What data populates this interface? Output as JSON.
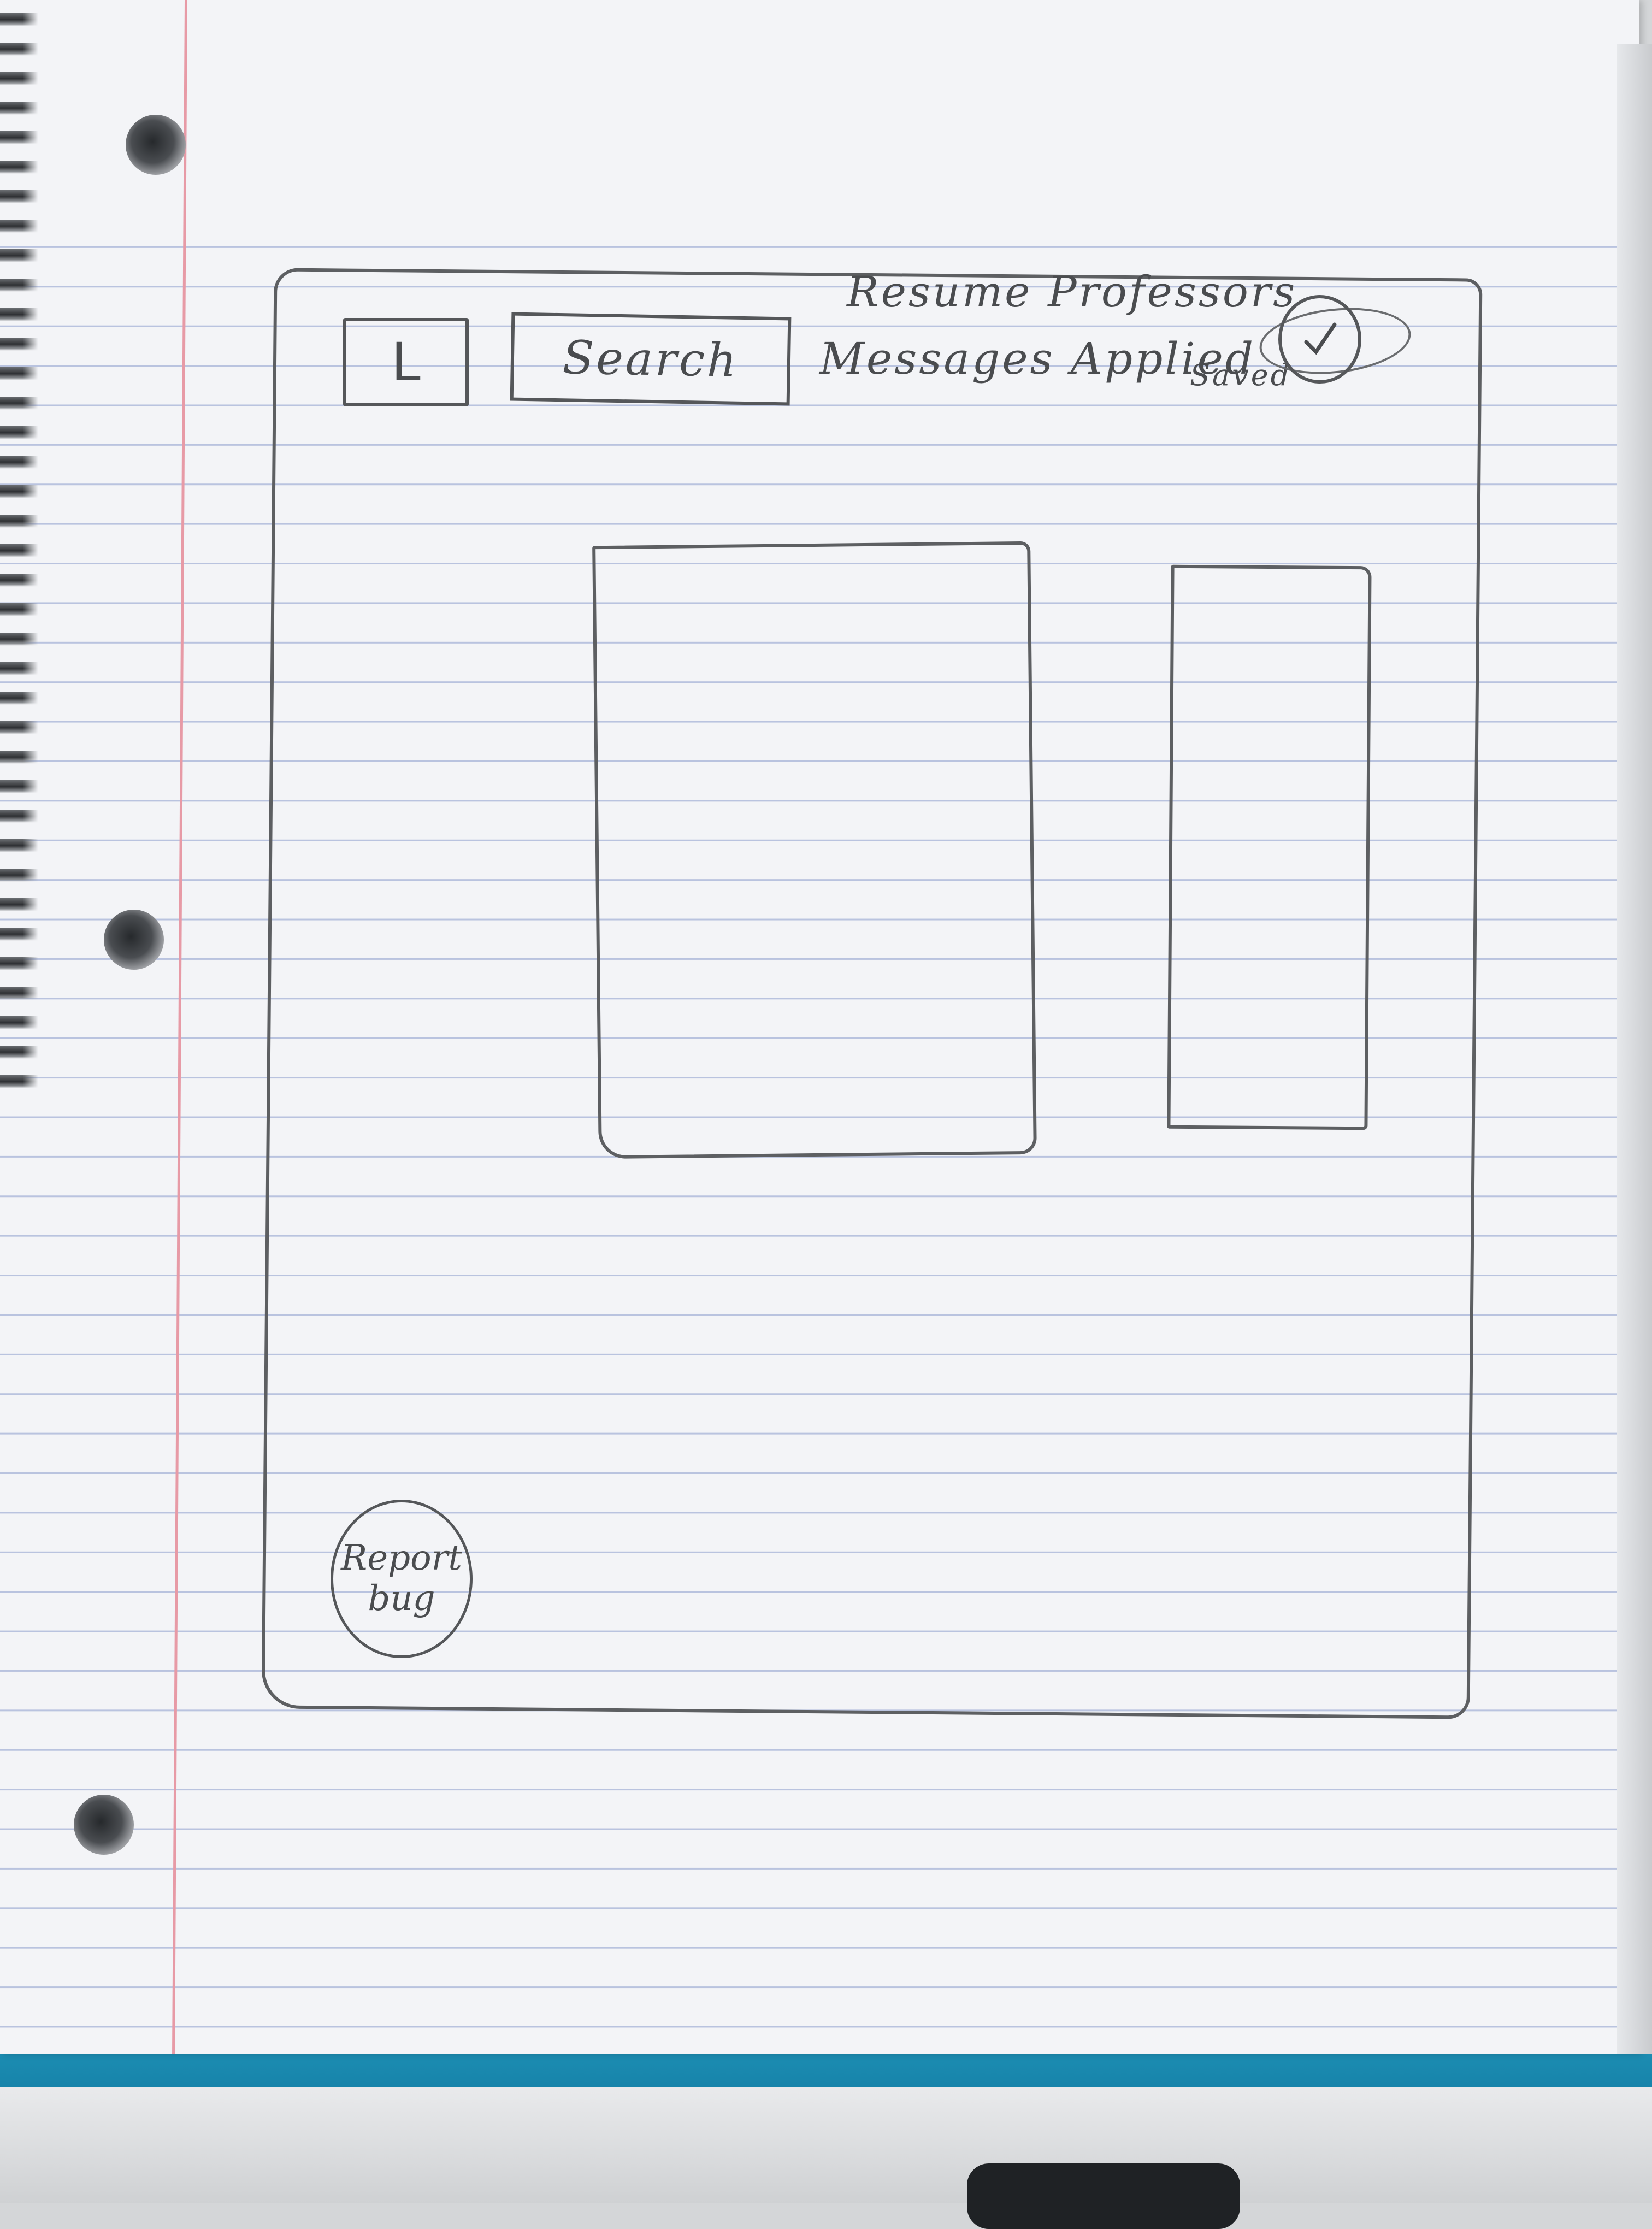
{
  "wireframe": {
    "logo_letter": "L",
    "search_label": "Search",
    "nav_top": "Resume Professors",
    "nav_bottom": "Messages Applied",
    "nav_saved": "Saved",
    "report_bug_line1": "Report",
    "report_bug_line2": "bug"
  },
  "colors": {
    "pencil": "#55575a",
    "paper": "#f3f4f7",
    "ruled_line": "#b9c3df",
    "margin_line": "#e79aa6",
    "folder_blue": "#137fa6"
  },
  "icons": {
    "avatar": "profile-avatar-icon",
    "logo": "logo-icon"
  }
}
